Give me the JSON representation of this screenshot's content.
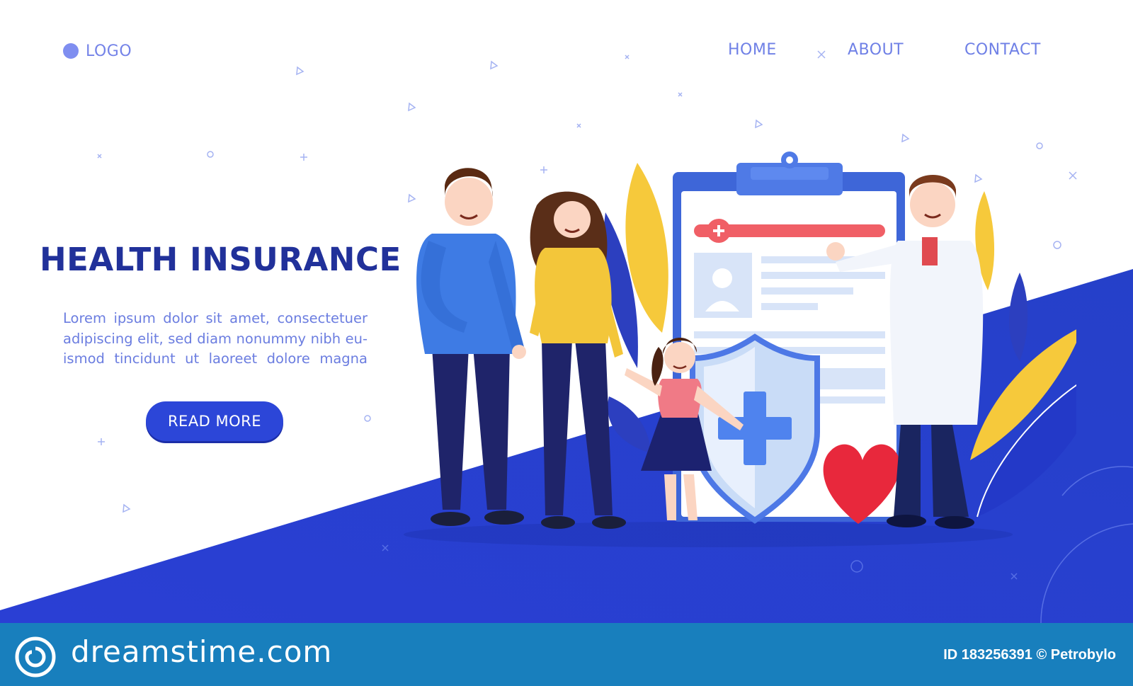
{
  "header": {
    "logo_label": "LOGO",
    "nav": [
      {
        "label": "HOME"
      },
      {
        "label": "ABOUT"
      },
      {
        "label": "CONTACT"
      }
    ]
  },
  "hero": {
    "title": "HEALTH INSURANCE",
    "body": "Lorem ipsum dolor sit amet, consectetuer adipiscing elit, sed diam nonummy nibh eu-ismod tincidunt ut laoreet dolore magna",
    "button_label": "READ MORE"
  },
  "watermark": {
    "brand": "dreamstime.com",
    "id_text": "ID 183256391 © Petrobylo"
  },
  "colors": {
    "accent": "#2c46d8",
    "title": "#21319a",
    "nav": "#6f80e6",
    "footer": "#187fbd"
  },
  "icons": [
    "logo-dot-icon",
    "shield-cross-icon",
    "heart-icon",
    "clipboard-icon",
    "dreamstime-spiral-icon"
  ]
}
